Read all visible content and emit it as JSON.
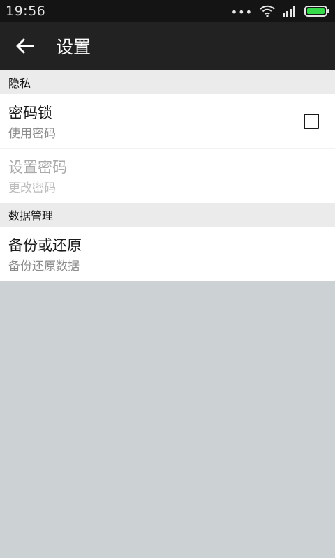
{
  "status_bar": {
    "time": "19:56",
    "icons": [
      "more-dots-icon",
      "wifi-icon",
      "signal-icon",
      "battery-icon"
    ],
    "battery_color": "#35d94a"
  },
  "action_bar": {
    "back_icon": "arrow-left-icon",
    "title": "设置"
  },
  "sections": [
    {
      "header": "隐私",
      "items": [
        {
          "title": "密码锁",
          "summary": "使用密码",
          "control": "checkbox",
          "checked": false,
          "enabled": true
        },
        {
          "title": "设置密码",
          "summary": "更改密码",
          "enabled": false
        }
      ]
    },
    {
      "header": "数据管理",
      "items": [
        {
          "title": "备份或还原",
          "summary": "备份还原数据",
          "enabled": true
        }
      ]
    }
  ],
  "colors": {
    "status_bar_bg": "#141414",
    "action_bar_bg": "#222222",
    "section_header_bg": "#ebebeb",
    "page_bg": "#ccd1d4"
  }
}
